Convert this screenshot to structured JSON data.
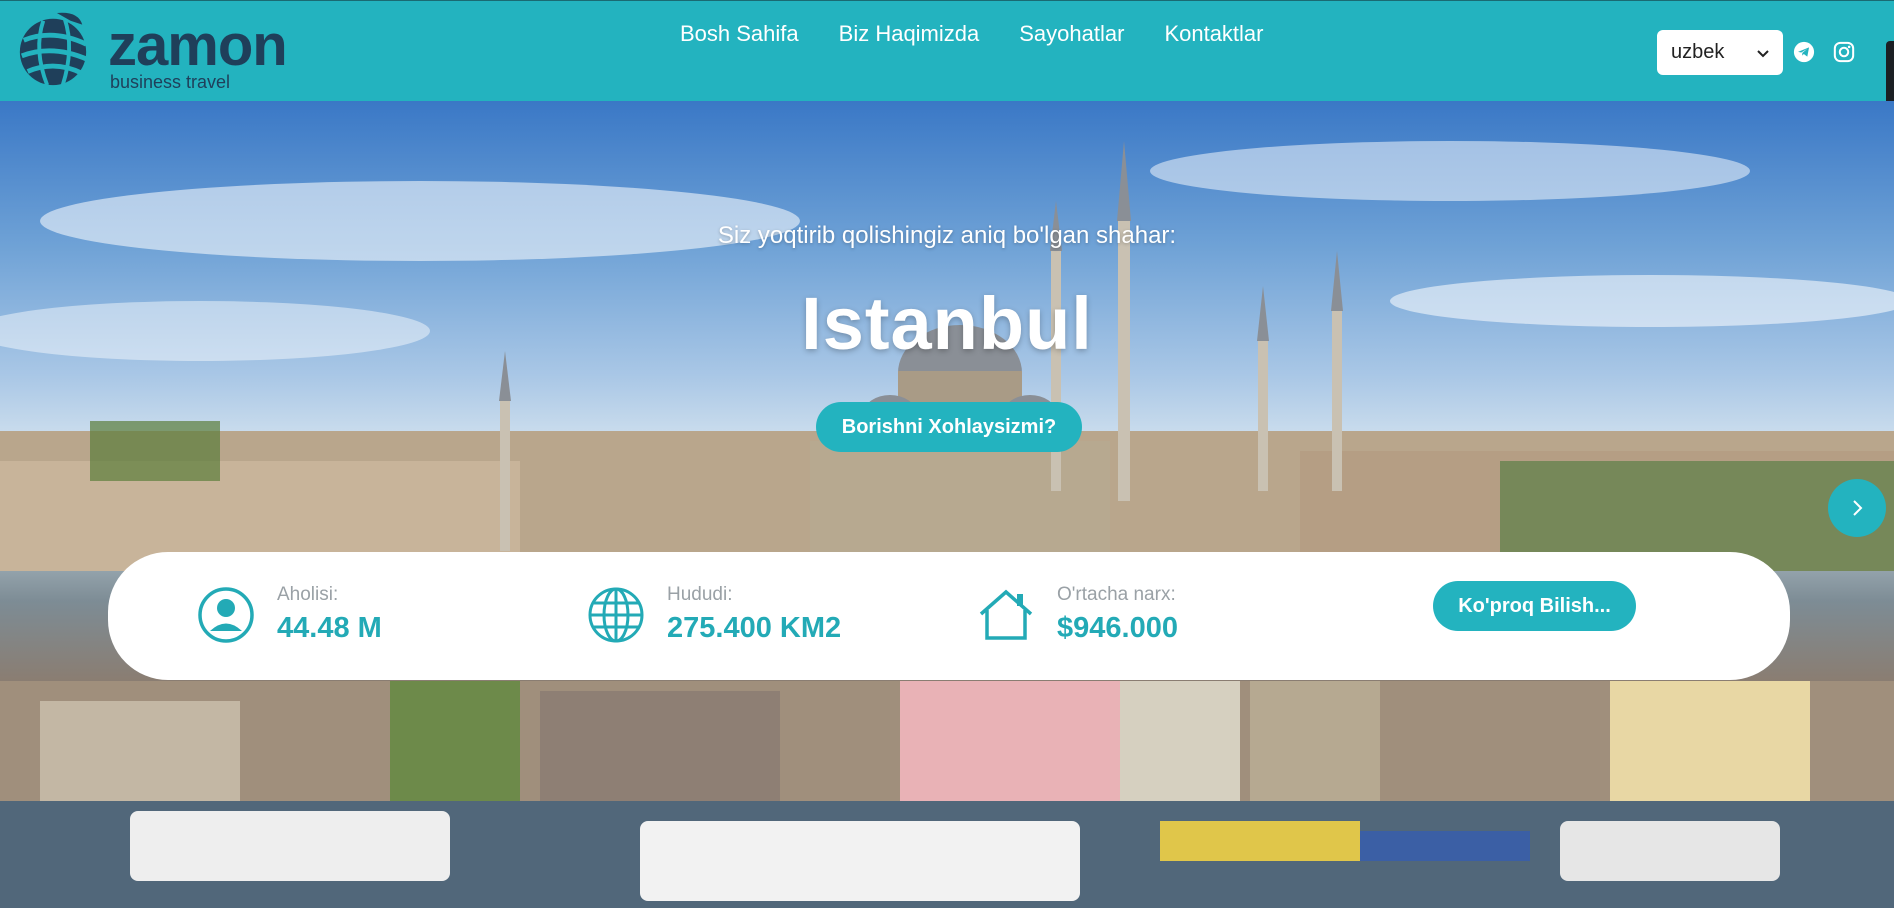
{
  "brand": {
    "name": "zamon",
    "tagline": "business travel",
    "logo_icon": "globe-logo-icon",
    "color": "#23b3bf"
  },
  "nav": {
    "items": [
      {
        "label": "Bosh Sahifa"
      },
      {
        "label": "Biz Haqimizda"
      },
      {
        "label": "Sayohatlar"
      },
      {
        "label": "Kontaktlar"
      }
    ]
  },
  "language": {
    "selected": "uzbek"
  },
  "social": {
    "telegram_icon": "telegram-icon",
    "instagram_icon": "instagram-icon"
  },
  "hero": {
    "subtitle": "Siz yoqtirib qolishingiz aniq bo'lgan shahar:",
    "city": "Istanbul",
    "cta_label": "Borishni Xohlaysizmi?",
    "next_icon": "chevron-right-icon"
  },
  "stats": [
    {
      "label": "Aholisi:",
      "value": "44.48 M",
      "icon": "user-circle-icon"
    },
    {
      "label": "Hududi:",
      "value": "275.400 KM2",
      "icon": "globe-icon"
    },
    {
      "label": "O'rtacha narx:",
      "value": "$946.000",
      "icon": "house-icon"
    }
  ],
  "more_label": "Ko'proq Bilish..."
}
